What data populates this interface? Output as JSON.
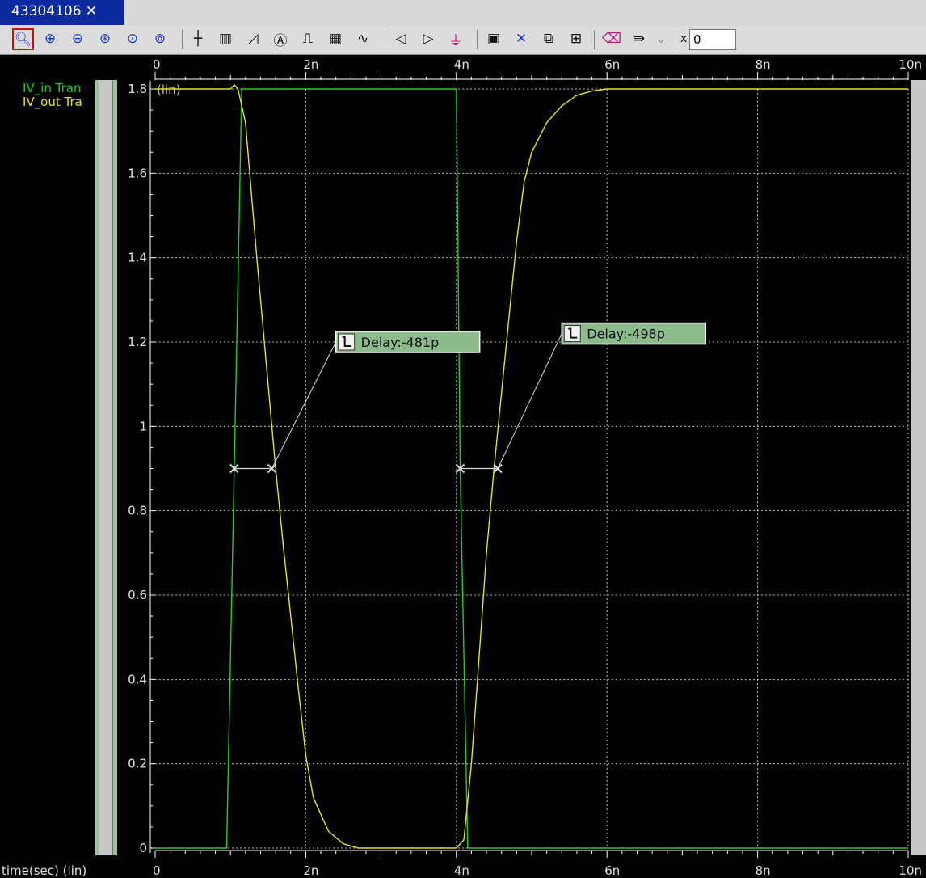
{
  "window": {
    "tab_title": "43304106 ✕"
  },
  "toolbar": {
    "tools": [
      {
        "name": "zoom-box-icon",
        "glyph": "🔍︎"
      },
      {
        "name": "zoom-in-icon",
        "glyph": "⊕"
      },
      {
        "name": "zoom-out-icon",
        "glyph": "⊖"
      },
      {
        "name": "zoom-fit-icon",
        "glyph": "⊛"
      },
      {
        "name": "zoom-previous-icon",
        "glyph": "⊙"
      },
      {
        "name": "zoom-next-icon",
        "glyph": "⊚"
      },
      {
        "name": "crosshair-icon",
        "glyph": "┼"
      },
      {
        "name": "bus-icon",
        "glyph": "▥"
      },
      {
        "name": "measure-icon",
        "glyph": "◿"
      },
      {
        "name": "label-icon",
        "glyph": "Ⓐ"
      },
      {
        "name": "pulse-icon",
        "glyph": "⎍"
      },
      {
        "name": "grid-icon",
        "glyph": "▦"
      },
      {
        "name": "waveform-icon",
        "glyph": "∿"
      },
      {
        "name": "previous-edge-icon",
        "glyph": "◁"
      },
      {
        "name": "next-edge-icon",
        "glyph": "▷"
      },
      {
        "name": "edge-marker-icon",
        "glyph": "⏚"
      },
      {
        "name": "panel-icon",
        "glyph": "▣"
      },
      {
        "name": "delete-icon",
        "glyph": "✕"
      },
      {
        "name": "group-icon",
        "glyph": "⧉"
      },
      {
        "name": "ungroup-icon",
        "glyph": "⊞"
      },
      {
        "name": "eraser-icon",
        "glyph": "⌫"
      },
      {
        "name": "export-icon",
        "glyph": "⇛"
      },
      {
        "name": "dropdown-icon",
        "glyph": "⌄"
      }
    ],
    "x_label": "x",
    "x_value": "0"
  },
  "legend": [
    {
      "name": "IV_in",
      "suffix": "Tran",
      "color": "#22d022"
    },
    {
      "name": "IV_out",
      "suffix": "Tra",
      "color": "#e6e619"
    }
  ],
  "chart_data": {
    "type": "line",
    "xlabel": "time(sec) (lin)",
    "ylabel": "(lin)",
    "xlim": [
      0,
      10
    ],
    "x_unit": "n",
    "ylim": [
      0,
      1.8
    ],
    "x_ticks": [
      "0",
      "2n",
      "4n",
      "6n",
      "8n",
      "10n"
    ],
    "x_tick_values": [
      0,
      2,
      4,
      6,
      8,
      10
    ],
    "y_ticks": [
      "0",
      "0.2",
      "0.4",
      "0.6",
      "0.8",
      "1",
      "1.2",
      "1.4",
      "1.6",
      "1.8"
    ],
    "y_tick_values": [
      0,
      0.2,
      0.4,
      0.6,
      0.8,
      1.0,
      1.2,
      1.4,
      1.6,
      1.8
    ],
    "grid": true,
    "series": [
      {
        "name": "IV_in",
        "color": "#22d022",
        "x": [
          0,
          0.95,
          1.05,
          1.15,
          4.0,
          4.05,
          4.15,
          10
        ],
        "y": [
          0,
          0,
          0.9,
          1.8,
          1.8,
          0.9,
          0,
          0
        ]
      },
      {
        "name": "IV_out",
        "color": "#e6e619",
        "x": [
          0,
          0.95,
          1.0,
          1.05,
          1.1,
          1.2,
          1.35,
          1.5,
          1.6,
          1.7,
          1.8,
          1.9,
          2.0,
          2.1,
          2.3,
          2.5,
          2.7,
          3.0,
          3.8,
          4.0,
          4.1,
          4.2,
          4.3,
          4.4,
          4.5,
          4.6,
          4.7,
          4.8,
          4.9,
          5.0,
          5.2,
          5.4,
          5.6,
          5.8,
          6.0,
          6.2,
          10
        ],
        "y": [
          1.8,
          1.8,
          1.8,
          1.81,
          1.8,
          1.72,
          1.4,
          1.1,
          0.9,
          0.72,
          0.55,
          0.38,
          0.22,
          0.12,
          0.04,
          0.01,
          0.0,
          0.0,
          0.0,
          0.0,
          0.02,
          0.2,
          0.45,
          0.7,
          0.9,
          1.08,
          1.26,
          1.44,
          1.58,
          1.65,
          1.72,
          1.76,
          1.785,
          1.795,
          1.8,
          1.8,
          1.8
        ]
      }
    ],
    "measurements": [
      {
        "label": "Delay:-481p",
        "points": [
          [
            1.05,
            0.9
          ],
          [
            1.55,
            0.9
          ]
        ],
        "anchor": [
          1.55,
          0.9
        ],
        "tag_at": [
          2.4,
          1.2
        ]
      },
      {
        "label": "Delay:-498p",
        "points": [
          [
            4.05,
            0.9
          ],
          [
            4.55,
            0.9
          ]
        ],
        "anchor": [
          4.55,
          0.9
        ],
        "tag_at": [
          5.4,
          1.22
        ]
      }
    ],
    "colors": {
      "grid": "#bdbdbd",
      "marker": "#d8d8d8",
      "tag_bg": "#8cbc8c",
      "tag_border": "#ffffff"
    }
  }
}
